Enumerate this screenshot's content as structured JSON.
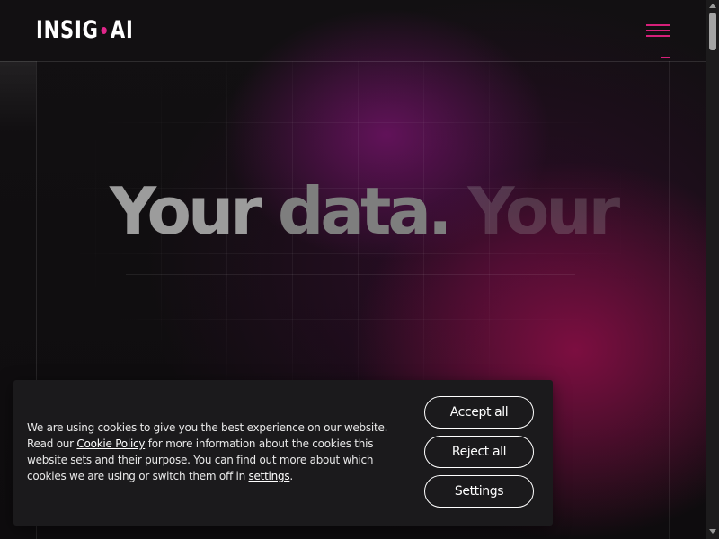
{
  "header": {
    "logo_left": "INSIG",
    "logo_right": "AI",
    "menu_icon": "hamburger-menu-icon"
  },
  "hero": {
    "word1": "Your ",
    "word2": "data.",
    "word3": " Your"
  },
  "cookie_banner": {
    "text_part1": "We are using cookies to give you the best experience on our website. Read our ",
    "cookie_policy_link": "Cookie Policy",
    "text_part2": " for more information about the cookies this website sets and their purpose. You can find out more about which cookies we are using or switch them off in ",
    "settings_link": "settings",
    "text_part3": ".",
    "accept_label": "Accept all",
    "reject_label": "Reject all",
    "settings_label": "Settings"
  },
  "colors": {
    "accent": "#d6207a",
    "background": "#0e0c0e",
    "banner": "#1b1a1c"
  }
}
